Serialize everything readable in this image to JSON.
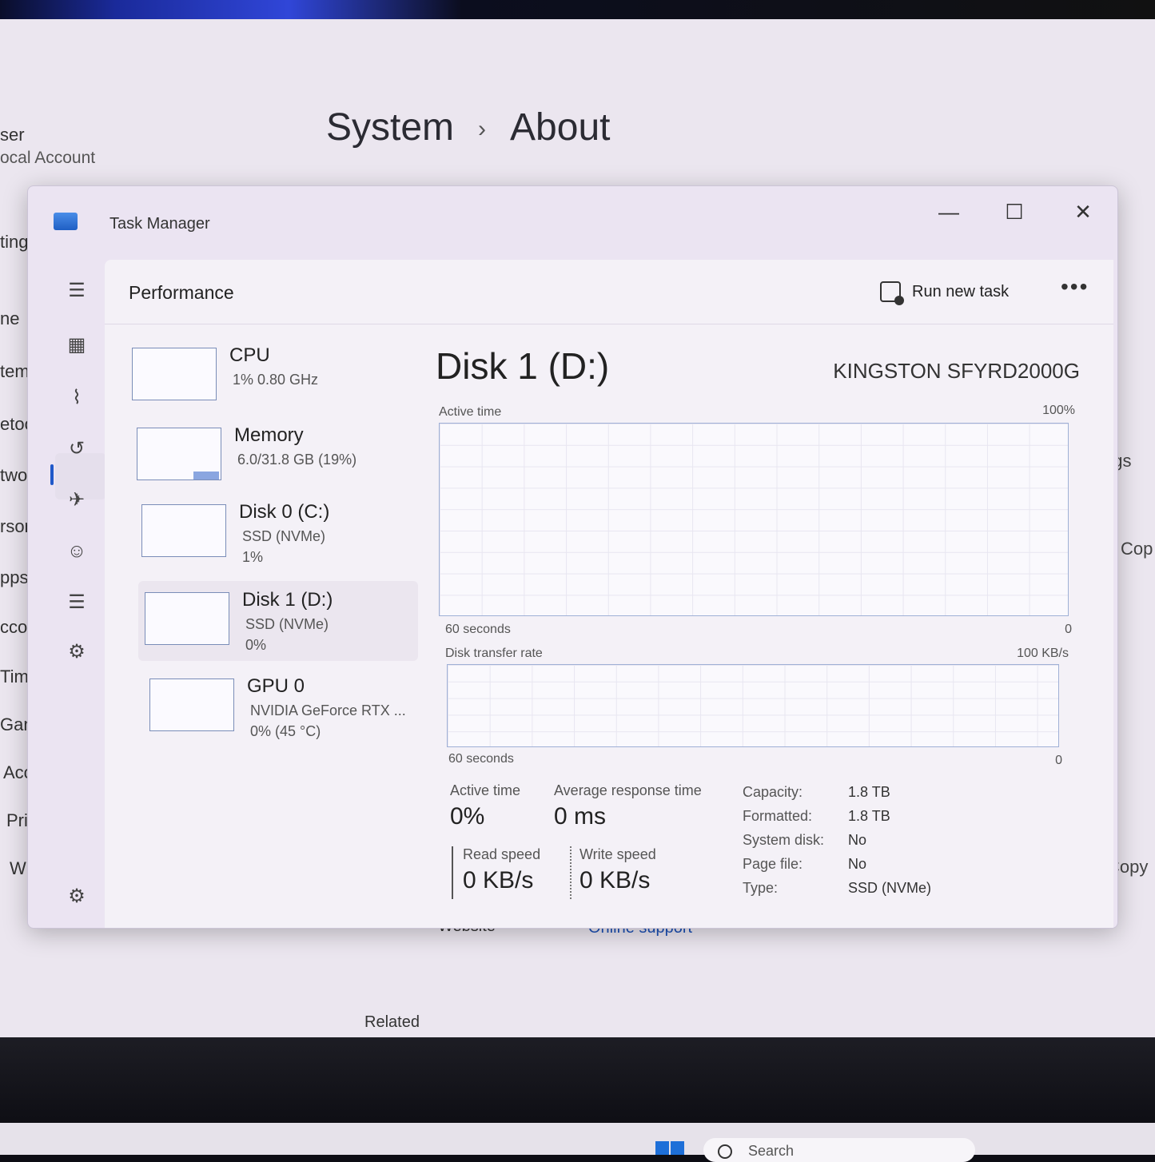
{
  "settings": {
    "breadcrumb": [
      "System",
      "About"
    ],
    "user_name": "ser",
    "user_account": "ocal Account",
    "nav": [
      "ting",
      "ne",
      "tem",
      "etoot",
      "twork",
      "rsonal",
      "pps",
      "ccount",
      "Time & l",
      "Gaming",
      "Accessib",
      "Privacy &",
      "Window"
    ],
    "right_labels": [
      "ngs",
      "Cop",
      "Copy"
    ],
    "links": {
      "website": "Website",
      "online_support": "Online support"
    },
    "related": "Related"
  },
  "taskbar": {
    "search_placeholder": "Search"
  },
  "task_manager": {
    "title": "Task Manager",
    "window_controls": {
      "minimize": "—",
      "maximize": "☐",
      "close": "✕"
    },
    "page_title": "Performance",
    "run_new_task": "Run new task",
    "more": "•••",
    "devices": [
      {
        "name": "CPU",
        "line1": "1%  0.80 GHz",
        "line2": ""
      },
      {
        "name": "Memory",
        "line1": "6.0/31.8 GB (19%)",
        "line2": ""
      },
      {
        "name": "Disk 0 (C:)",
        "line1": "SSD (NVMe)",
        "line2": "1%"
      },
      {
        "name": "Disk 1 (D:)",
        "line1": "SSD (NVMe)",
        "line2": "0%"
      },
      {
        "name": "GPU 0",
        "line1": "NVIDIA GeForce RTX ...",
        "line2": "0%  (45 °C)"
      }
    ],
    "detail": {
      "title": "Disk 1 (D:)",
      "model": "KINGSTON SFYRD2000G",
      "graph1": {
        "label": "Active time",
        "max": "100%",
        "x_left": "60 seconds",
        "x_right": "0"
      },
      "graph2": {
        "label": "Disk transfer rate",
        "max": "100 KB/s",
        "x_left": "60 seconds",
        "x_right": "0"
      },
      "stats": {
        "active_time_label": "Active time",
        "active_time_value": "0%",
        "avg_resp_label": "Average response time",
        "avg_resp_value": "0 ms",
        "read_label": "Read speed",
        "read_value": "0 KB/s",
        "write_label": "Write speed",
        "write_value": "0 KB/s"
      },
      "properties": [
        {
          "key": "Capacity:",
          "value": "1.8 TB"
        },
        {
          "key": "Formatted:",
          "value": "1.8 TB"
        },
        {
          "key": "System disk:",
          "value": "No"
        },
        {
          "key": "Page file:",
          "value": "No"
        },
        {
          "key": "Type:",
          "value": "SSD (NVMe)"
        }
      ]
    }
  },
  "colors": {
    "accent": "#2059c9",
    "graph_border": "#9fb0d6",
    "window_bg": "#ebe4f2"
  }
}
